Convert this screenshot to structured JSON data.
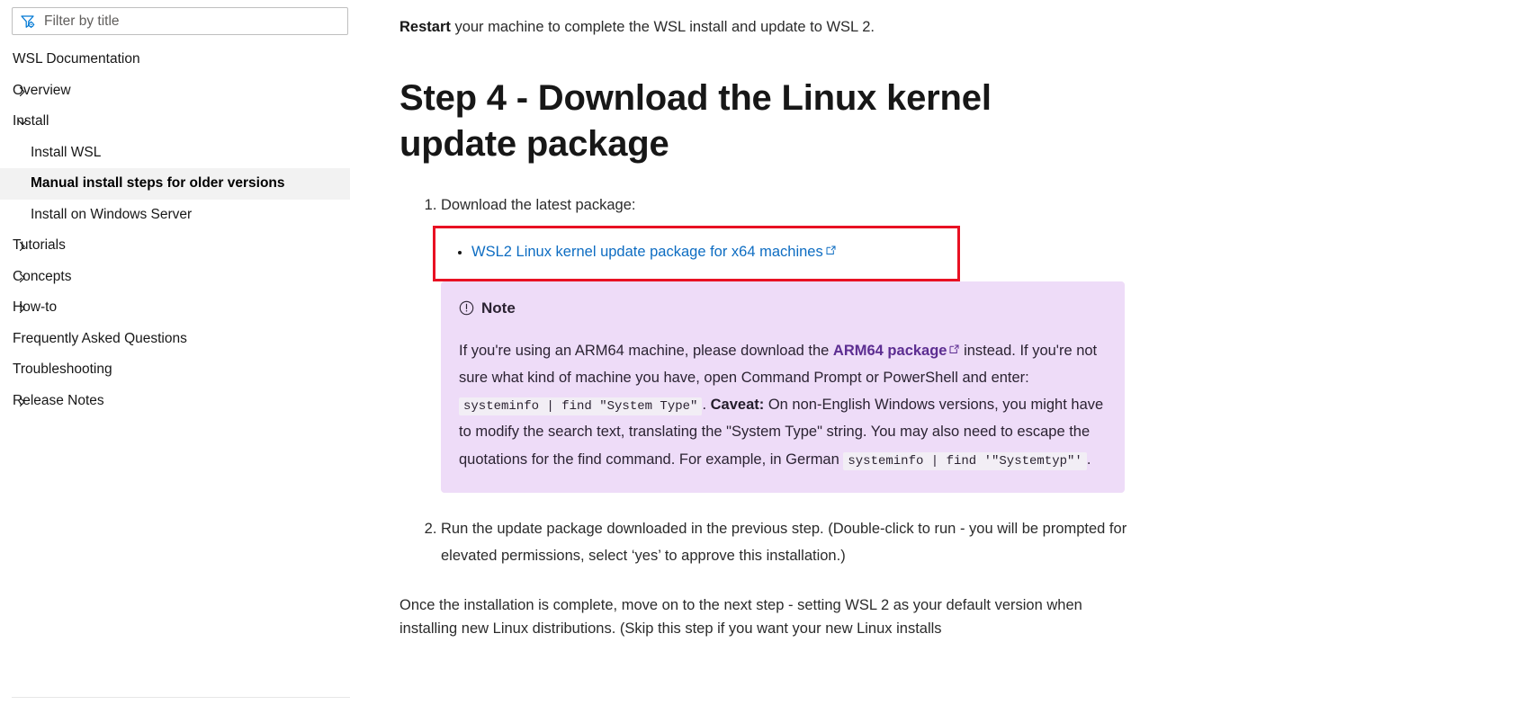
{
  "sidebar": {
    "filter": {
      "placeholder": "Filter by title",
      "value": "",
      "icon": "filter-icon"
    },
    "items": [
      {
        "label": "WSL Documentation",
        "level": 0,
        "chevron": "none",
        "selected": false
      },
      {
        "label": "Overview",
        "level": 0,
        "chevron": "right",
        "selected": false
      },
      {
        "label": "Install",
        "level": 0,
        "chevron": "down",
        "selected": false
      },
      {
        "label": "Install WSL",
        "level": 1,
        "chevron": "none",
        "selected": false
      },
      {
        "label": "Manual install steps for older versions",
        "level": 1,
        "chevron": "none",
        "selected": true
      },
      {
        "label": "Install on Windows Server",
        "level": 1,
        "chevron": "none",
        "selected": false
      },
      {
        "label": "Tutorials",
        "level": 0,
        "chevron": "right",
        "selected": false
      },
      {
        "label": "Concepts",
        "level": 0,
        "chevron": "right",
        "selected": false
      },
      {
        "label": "How-to",
        "level": 0,
        "chevron": "right",
        "selected": false
      },
      {
        "label": "Frequently Asked Questions",
        "level": 0,
        "chevron": "none",
        "selected": false
      },
      {
        "label": "Troubleshooting",
        "level": 0,
        "chevron": "none",
        "selected": false
      },
      {
        "label": "Release Notes",
        "level": 0,
        "chevron": "right",
        "selected": false
      }
    ]
  },
  "main": {
    "lead_bold": "Restart",
    "lead_rest": " your machine to complete the WSL install and update to WSL 2.",
    "heading": "Step 4 - Download the Linux kernel update package",
    "step1_text": "Download the latest package:",
    "download_link": "WSL2 Linux kernel update package for x64 machines",
    "note": {
      "title": "Note",
      "icon": "info-circle-icon",
      "part1": "If you're using an ARM64 machine, please download the ",
      "link": "ARM64 package",
      "part2": " instead. If you're not sure what kind of machine you have, open Command Prompt or PowerShell and enter: ",
      "code1": "systeminfo | find \"System Type\"",
      "part3": ". ",
      "caveat_bold": "Caveat:",
      "part4": " On non-English Windows versions, you might have to modify the search text, translating the \"System Type\" string. You may also need to escape the quotations for the find command. For example, in German ",
      "code2": "systeminfo | find '\"Systemtyp\"'",
      "part5": "."
    },
    "step2_text": "Run the update package downloaded in the previous step. (Double-click to run - you will be prompted for elevated permissions, select ‘yes’ to approve this installation.)",
    "tail_para": "Once the installation is complete, move on to the next step - setting WSL 2 as your default version when installing new Linux distributions. (Skip this step if you want your new Linux installs"
  },
  "colors": {
    "highlight_red": "#e81123",
    "note_background": "#eedcf8",
    "link_blue": "#0e6dc2",
    "note_link_purple": "#5c2d91",
    "selected_row": "#f2f2f2"
  }
}
